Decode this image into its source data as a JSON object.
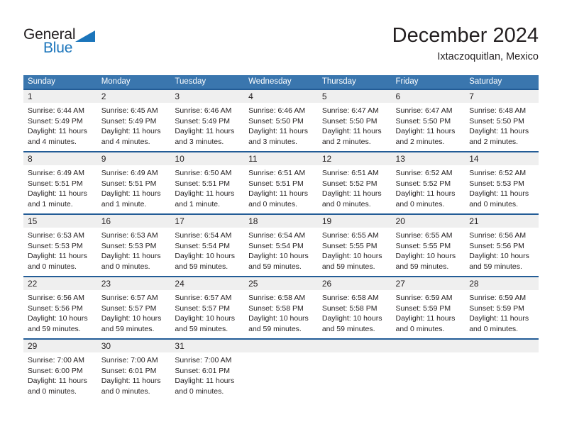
{
  "brand": {
    "name_top": "General",
    "name_bottom": "Blue",
    "color_dark": "#231f20",
    "color_blue": "#1b75bb"
  },
  "header": {
    "title": "December 2024",
    "subtitle": "Ixtaczoquitlan, Mexico"
  },
  "theme": {
    "header_bg": "#3a76ae",
    "row_border": "#235c96",
    "daynum_bg": "#efefef",
    "text": "#231f20"
  },
  "calendar": {
    "weekday_headers": [
      "Sunday",
      "Monday",
      "Tuesday",
      "Wednesday",
      "Thursday",
      "Friday",
      "Saturday"
    ],
    "weeks": [
      [
        {
          "day": "1",
          "sunrise": "Sunrise: 6:44 AM",
          "sunset": "Sunset: 5:49 PM",
          "daylight_line1": "Daylight: 11 hours",
          "daylight_line2": "and 4 minutes."
        },
        {
          "day": "2",
          "sunrise": "Sunrise: 6:45 AM",
          "sunset": "Sunset: 5:49 PM",
          "daylight_line1": "Daylight: 11 hours",
          "daylight_line2": "and 4 minutes."
        },
        {
          "day": "3",
          "sunrise": "Sunrise: 6:46 AM",
          "sunset": "Sunset: 5:49 PM",
          "daylight_line1": "Daylight: 11 hours",
          "daylight_line2": "and 3 minutes."
        },
        {
          "day": "4",
          "sunrise": "Sunrise: 6:46 AM",
          "sunset": "Sunset: 5:50 PM",
          "daylight_line1": "Daylight: 11 hours",
          "daylight_line2": "and 3 minutes."
        },
        {
          "day": "5",
          "sunrise": "Sunrise: 6:47 AM",
          "sunset": "Sunset: 5:50 PM",
          "daylight_line1": "Daylight: 11 hours",
          "daylight_line2": "and 2 minutes."
        },
        {
          "day": "6",
          "sunrise": "Sunrise: 6:47 AM",
          "sunset": "Sunset: 5:50 PM",
          "daylight_line1": "Daylight: 11 hours",
          "daylight_line2": "and 2 minutes."
        },
        {
          "day": "7",
          "sunrise": "Sunrise: 6:48 AM",
          "sunset": "Sunset: 5:50 PM",
          "daylight_line1": "Daylight: 11 hours",
          "daylight_line2": "and 2 minutes."
        }
      ],
      [
        {
          "day": "8",
          "sunrise": "Sunrise: 6:49 AM",
          "sunset": "Sunset: 5:51 PM",
          "daylight_line1": "Daylight: 11 hours",
          "daylight_line2": "and 1 minute."
        },
        {
          "day": "9",
          "sunrise": "Sunrise: 6:49 AM",
          "sunset": "Sunset: 5:51 PM",
          "daylight_line1": "Daylight: 11 hours",
          "daylight_line2": "and 1 minute."
        },
        {
          "day": "10",
          "sunrise": "Sunrise: 6:50 AM",
          "sunset": "Sunset: 5:51 PM",
          "daylight_line1": "Daylight: 11 hours",
          "daylight_line2": "and 1 minute."
        },
        {
          "day": "11",
          "sunrise": "Sunrise: 6:51 AM",
          "sunset": "Sunset: 5:51 PM",
          "daylight_line1": "Daylight: 11 hours",
          "daylight_line2": "and 0 minutes."
        },
        {
          "day": "12",
          "sunrise": "Sunrise: 6:51 AM",
          "sunset": "Sunset: 5:52 PM",
          "daylight_line1": "Daylight: 11 hours",
          "daylight_line2": "and 0 minutes."
        },
        {
          "day": "13",
          "sunrise": "Sunrise: 6:52 AM",
          "sunset": "Sunset: 5:52 PM",
          "daylight_line1": "Daylight: 11 hours",
          "daylight_line2": "and 0 minutes."
        },
        {
          "day": "14",
          "sunrise": "Sunrise: 6:52 AM",
          "sunset": "Sunset: 5:53 PM",
          "daylight_line1": "Daylight: 11 hours",
          "daylight_line2": "and 0 minutes."
        }
      ],
      [
        {
          "day": "15",
          "sunrise": "Sunrise: 6:53 AM",
          "sunset": "Sunset: 5:53 PM",
          "daylight_line1": "Daylight: 11 hours",
          "daylight_line2": "and 0 minutes."
        },
        {
          "day": "16",
          "sunrise": "Sunrise: 6:53 AM",
          "sunset": "Sunset: 5:53 PM",
          "daylight_line1": "Daylight: 11 hours",
          "daylight_line2": "and 0 minutes."
        },
        {
          "day": "17",
          "sunrise": "Sunrise: 6:54 AM",
          "sunset": "Sunset: 5:54 PM",
          "daylight_line1": "Daylight: 10 hours",
          "daylight_line2": "and 59 minutes."
        },
        {
          "day": "18",
          "sunrise": "Sunrise: 6:54 AM",
          "sunset": "Sunset: 5:54 PM",
          "daylight_line1": "Daylight: 10 hours",
          "daylight_line2": "and 59 minutes."
        },
        {
          "day": "19",
          "sunrise": "Sunrise: 6:55 AM",
          "sunset": "Sunset: 5:55 PM",
          "daylight_line1": "Daylight: 10 hours",
          "daylight_line2": "and 59 minutes."
        },
        {
          "day": "20",
          "sunrise": "Sunrise: 6:55 AM",
          "sunset": "Sunset: 5:55 PM",
          "daylight_line1": "Daylight: 10 hours",
          "daylight_line2": "and 59 minutes."
        },
        {
          "day": "21",
          "sunrise": "Sunrise: 6:56 AM",
          "sunset": "Sunset: 5:56 PM",
          "daylight_line1": "Daylight: 10 hours",
          "daylight_line2": "and 59 minutes."
        }
      ],
      [
        {
          "day": "22",
          "sunrise": "Sunrise: 6:56 AM",
          "sunset": "Sunset: 5:56 PM",
          "daylight_line1": "Daylight: 10 hours",
          "daylight_line2": "and 59 minutes."
        },
        {
          "day": "23",
          "sunrise": "Sunrise: 6:57 AM",
          "sunset": "Sunset: 5:57 PM",
          "daylight_line1": "Daylight: 10 hours",
          "daylight_line2": "and 59 minutes."
        },
        {
          "day": "24",
          "sunrise": "Sunrise: 6:57 AM",
          "sunset": "Sunset: 5:57 PM",
          "daylight_line1": "Daylight: 10 hours",
          "daylight_line2": "and 59 minutes."
        },
        {
          "day": "25",
          "sunrise": "Sunrise: 6:58 AM",
          "sunset": "Sunset: 5:58 PM",
          "daylight_line1": "Daylight: 10 hours",
          "daylight_line2": "and 59 minutes."
        },
        {
          "day": "26",
          "sunrise": "Sunrise: 6:58 AM",
          "sunset": "Sunset: 5:58 PM",
          "daylight_line1": "Daylight: 10 hours",
          "daylight_line2": "and 59 minutes."
        },
        {
          "day": "27",
          "sunrise": "Sunrise: 6:59 AM",
          "sunset": "Sunset: 5:59 PM",
          "daylight_line1": "Daylight: 11 hours",
          "daylight_line2": "and 0 minutes."
        },
        {
          "day": "28",
          "sunrise": "Sunrise: 6:59 AM",
          "sunset": "Sunset: 5:59 PM",
          "daylight_line1": "Daylight: 11 hours",
          "daylight_line2": "and 0 minutes."
        }
      ],
      [
        {
          "day": "29",
          "sunrise": "Sunrise: 7:00 AM",
          "sunset": "Sunset: 6:00 PM",
          "daylight_line1": "Daylight: 11 hours",
          "daylight_line2": "and 0 minutes."
        },
        {
          "day": "30",
          "sunrise": "Sunrise: 7:00 AM",
          "sunset": "Sunset: 6:01 PM",
          "daylight_line1": "Daylight: 11 hours",
          "daylight_line2": "and 0 minutes."
        },
        {
          "day": "31",
          "sunrise": "Sunrise: 7:00 AM",
          "sunset": "Sunset: 6:01 PM",
          "daylight_line1": "Daylight: 11 hours",
          "daylight_line2": "and 0 minutes."
        },
        {
          "day": "",
          "sunrise": "",
          "sunset": "",
          "daylight_line1": "",
          "daylight_line2": ""
        },
        {
          "day": "",
          "sunrise": "",
          "sunset": "",
          "daylight_line1": "",
          "daylight_line2": ""
        },
        {
          "day": "",
          "sunrise": "",
          "sunset": "",
          "daylight_line1": "",
          "daylight_line2": ""
        },
        {
          "day": "",
          "sunrise": "",
          "sunset": "",
          "daylight_line1": "",
          "daylight_line2": ""
        }
      ]
    ]
  }
}
